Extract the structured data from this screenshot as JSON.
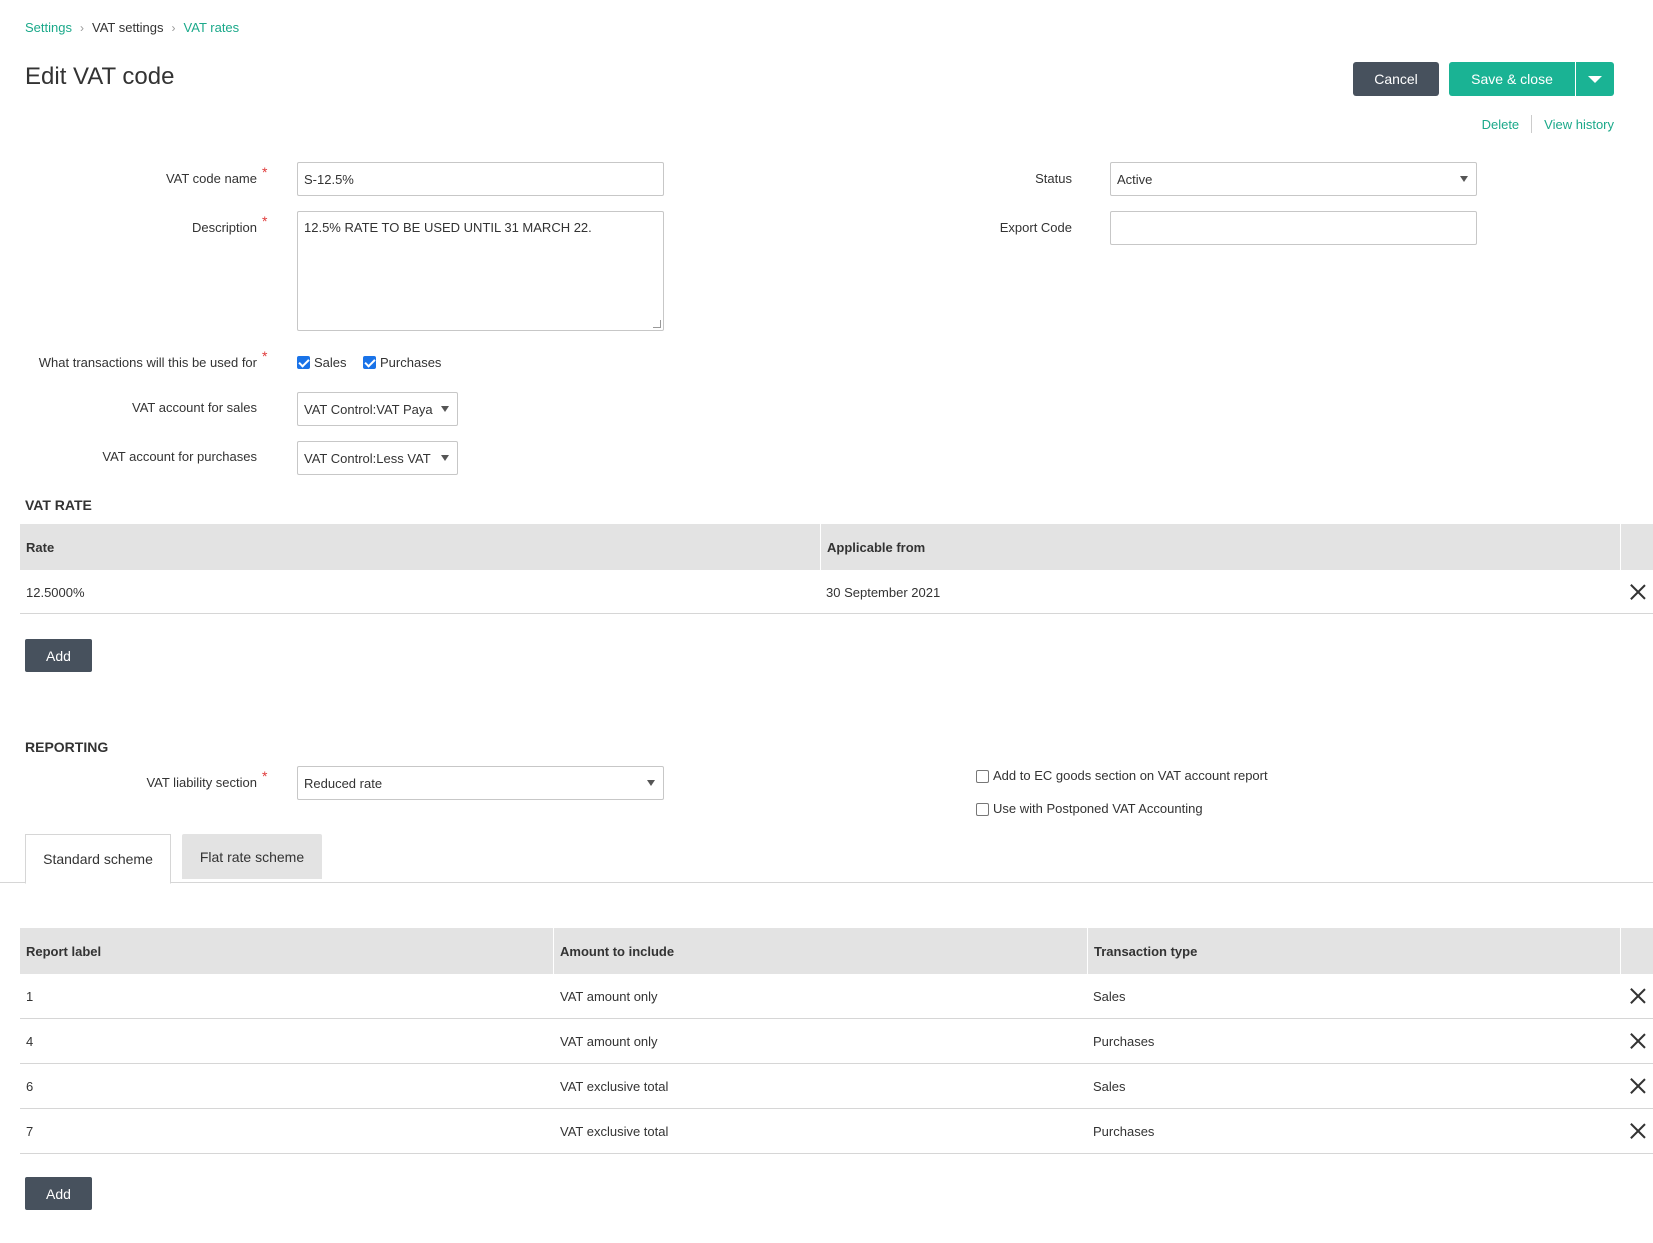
{
  "breadcrumb": {
    "items": [
      {
        "label": "Settings",
        "link": true
      },
      {
        "label": "VAT settings",
        "link": false
      },
      {
        "label": "VAT rates",
        "link": true
      }
    ]
  },
  "page_title": "Edit VAT code",
  "header_actions": {
    "cancel_label": "Cancel",
    "save_label": "Save & close",
    "delete_label": "Delete",
    "history_label": "View history"
  },
  "form": {
    "vat_code_name_label": "VAT code name",
    "vat_code_name_value": "S-12.5%",
    "description_label": "Description",
    "description_value": "12.5% RATE TO BE USED UNTIL 31 MARCH 22.",
    "status_label": "Status",
    "status_value": "Active",
    "export_code_label": "Export Code",
    "export_code_value": "",
    "transactions_label": "What transactions will this be used for",
    "sales_label": "Sales",
    "sales_checked": true,
    "purchases_label": "Purchases",
    "purchases_checked": true,
    "vat_sales_account_label": "VAT account for sales",
    "vat_sales_account_value": "VAT Control:VAT Paya",
    "vat_purchases_account_label": "VAT account for purchases",
    "vat_purchases_account_value": "VAT Control:Less VAT"
  },
  "vat_rate": {
    "section_title": "VAT RATE",
    "columns": [
      "Rate",
      "Applicable from"
    ],
    "rows": [
      {
        "rate": "12.5000%",
        "applicable_from": "30 September 2021"
      }
    ],
    "add_label": "Add"
  },
  "reporting": {
    "section_title": "REPORTING",
    "liability_label": "VAT liability section",
    "liability_value": "Reduced rate",
    "ec_goods_label": "Add to EC goods section on VAT account report",
    "ec_goods_checked": false,
    "postponed_label": "Use with Postponed VAT Accounting",
    "postponed_checked": false,
    "tabs": [
      {
        "label": "Standard scheme",
        "active": true
      },
      {
        "label": "Flat rate scheme",
        "active": false
      }
    ],
    "columns": [
      "Report label",
      "Amount to include",
      "Transaction type"
    ],
    "rows": [
      {
        "report_label": "1",
        "amount": "VAT amount only",
        "type": "Sales"
      },
      {
        "report_label": "4",
        "amount": "VAT amount only",
        "type": "Purchases"
      },
      {
        "report_label": "6",
        "amount": "VAT exclusive total",
        "type": "Sales"
      },
      {
        "report_label": "7",
        "amount": "VAT exclusive total",
        "type": "Purchases"
      }
    ],
    "add_label": "Add"
  },
  "colors": {
    "accent": "#1ab394",
    "link": "#1ba98a",
    "dark_button": "#47515d",
    "table_header": "#e3e3e3",
    "required": "#e03a3a"
  }
}
